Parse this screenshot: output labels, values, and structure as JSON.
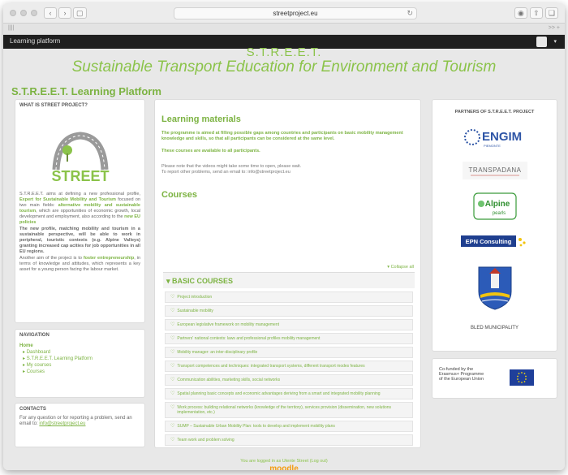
{
  "browser": {
    "url": "streetproject.eu",
    "tab_left": "||||",
    "tab_right": ">> +"
  },
  "topbar": {
    "brand": "Learning platform"
  },
  "site": {
    "acronym": "S.T.R.E.E.T.",
    "title": "Sustainable Transport Education for Environment and Tourism",
    "platform_title": "S.T.R.E.E.T. Learning Platform"
  },
  "about": {
    "heading": "WHAT IS STREET PROJECT?",
    "logo_text": "STREET",
    "p1a": "S.T.R.E.E.T. aims at defining a new professional profile, ",
    "p1b": "Expert for Sustainable Mobility and Tourism",
    "p1c": " focused on two main fields: ",
    "p1d": "alternative mobility and sustainable tourism",
    "p1e": ", which are opportunities of economic growth, local development and employment, also according to the ",
    "p1f": "new EU policies",
    "p2": "The new profile, matching mobility and tourism in a sustainable perspective, will be able to work in peripheral, touristic contexts (e.g. Alpine Valleys) granting increased cap acities for job opportunities in all EU regions.",
    "p3a": "Another aim of the project is to ",
    "p3b": "foster entrepreneurship",
    "p3c": ", in terms of knowledge and attitudes, which represents a key asset for a young person facing the labour market."
  },
  "navigation": {
    "heading": "NAVIGATION",
    "home": "Home",
    "items": [
      {
        "label": "Dashboard"
      },
      {
        "label": "S.T.R.E.E.T. Learning Platform"
      },
      {
        "label": "My courses"
      },
      {
        "label": "Courses"
      }
    ]
  },
  "contacts": {
    "heading": "CONTACTS",
    "text": "For any question or for reporting a problem, send an email to:",
    "email": "info@streetproject.eu"
  },
  "learning": {
    "heading": "Learning materials",
    "p1": "The programme is aimed at filling possible gaps among countries and participants on basic mobility management knowledge and skills, so that all participants can be considered at the same level.",
    "p2": "These courses are available to all participants.",
    "p3a": "Please note that the videos might take some time to open, please wait.",
    "p3b": "To report other problems, send an email to: info@streetproject.eu"
  },
  "courses": {
    "heading": "Courses",
    "collapse_label": "Collapse all",
    "category": "BASIC COURSES",
    "items": [
      {
        "label": "Project introduction"
      },
      {
        "label": "Sustainable mobility"
      },
      {
        "label": "European legislative framework on mobility management"
      },
      {
        "label": "Partners' national contexts: laws and professional profiles mobility management"
      },
      {
        "label": "Mobility manager: an inter-disciplinary profile"
      },
      {
        "label": "Transport competences and techniques: integrated transport systems, different transport modes features"
      },
      {
        "label": "Communication abilities, marketing skills, social networks"
      },
      {
        "label": "Spatial planning basic concepts and economic advantages deriving from a smart and integrated mobility planning"
      },
      {
        "label": "Work process: building relational networks (knowledge of the territory), services provision (dissemination, new solutions implementation, etc.)"
      },
      {
        "label": "SUMP – Sustainable Urban Mobility Plan: tools to develop and implement mobility plans"
      },
      {
        "label": "Team work and problem solving"
      }
    ]
  },
  "partners": {
    "heading": "PARTNERS OF S.T.R.E.E.T. PROJECT",
    "engim": "ENGIM",
    "engim_sub": "PIEMONTE",
    "transpadana": "TRANSPADANA",
    "alpine": "Alpine",
    "alpine_sub": "pearls",
    "epn": "EPN Consulting",
    "bled": "BLED MUNICIPALITY"
  },
  "funded": {
    "line1": "Co-funded by the",
    "line2": "Erasmus+ Programme",
    "line3": "of the European Union"
  },
  "footer": {
    "logged": "You are logged in as Utente Street (Log out)",
    "moodle": "moodle"
  },
  "colors": {
    "accent": "#7cb342",
    "moodle_orange": "#f39c12"
  }
}
